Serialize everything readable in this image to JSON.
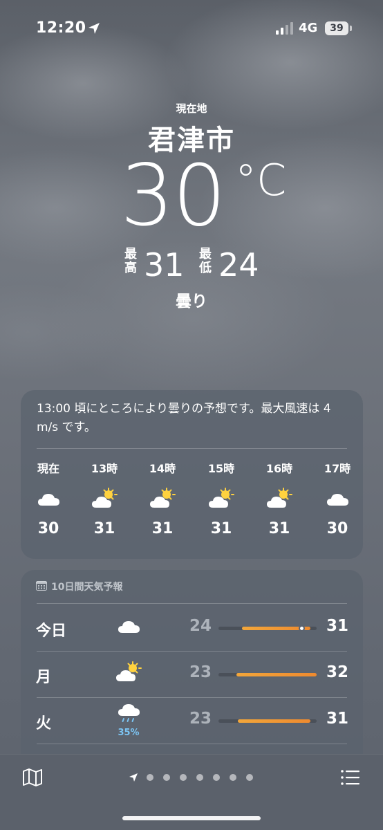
{
  "status_bar": {
    "time": "12:20",
    "network": "4G",
    "battery": "39"
  },
  "header": {
    "location_label": "現在地",
    "city": "君津市",
    "temperature": "30",
    "unit": "°C",
    "high_label": "最高",
    "high": "31",
    "low_label": "最低",
    "low": "24",
    "condition": "曇り"
  },
  "hourly": {
    "summary": "13:00 頃にところにより曇りの予想です。最大風速は 4 m/s です。",
    "items": [
      {
        "label": "現在",
        "icon": "cloud-icon",
        "temp": "30"
      },
      {
        "label": "13時",
        "icon": "partly-sunny-icon",
        "temp": "31"
      },
      {
        "label": "14時",
        "icon": "partly-sunny-icon",
        "temp": "31"
      },
      {
        "label": "15時",
        "icon": "partly-sunny-icon",
        "temp": "31"
      },
      {
        "label": "16時",
        "icon": "partly-sunny-icon",
        "temp": "31"
      },
      {
        "label": "17時",
        "icon": "cloud-icon",
        "temp": "30"
      }
    ]
  },
  "daily": {
    "title": "10日間天気予報",
    "items": [
      {
        "day": "今日",
        "icon": "cloud-icon",
        "precip": "",
        "low": "24",
        "high": "31",
        "range_start": 0.24,
        "range_end": 0.94,
        "current_marker": 0.85
      },
      {
        "day": "月",
        "icon": "partly-sunny-icon",
        "precip": "",
        "low": "23",
        "high": "32",
        "range_start": 0.18,
        "range_end": 1.0
      },
      {
        "day": "火",
        "icon": "rain-cloud-icon",
        "precip": "35%",
        "low": "23",
        "high": "31",
        "range_start": 0.2,
        "range_end": 0.94
      }
    ]
  },
  "colors": {
    "accent_bar": "#ef9a33",
    "precip": "#7cc4f3"
  },
  "pagination": {
    "pages": 8,
    "current": 0
  }
}
